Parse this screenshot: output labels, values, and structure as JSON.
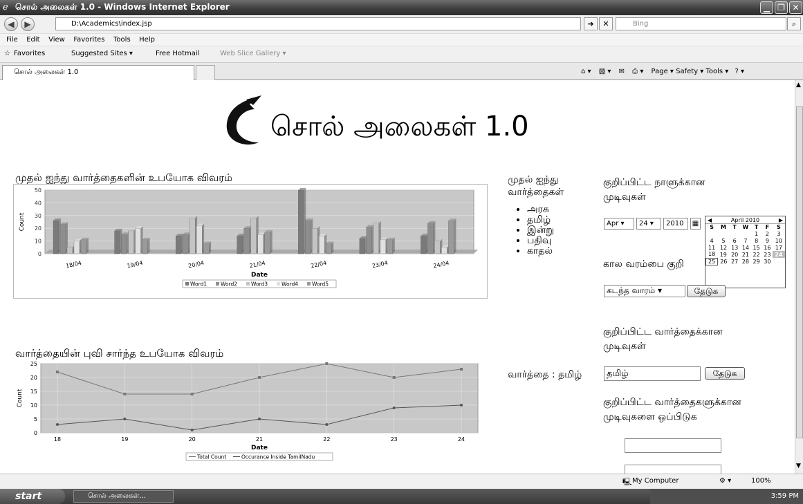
{
  "window": {
    "title": "சொல் அலைகள் 1.0 - Windows Internet Explorer",
    "address": "D:\\Academics\\index.jsp",
    "search_placeholder": "Bing",
    "menu": [
      "File",
      "Edit",
      "View",
      "Favorites",
      "Tools",
      "Help"
    ],
    "favorites": {
      "label": "Favorites",
      "items": [
        "Suggested Sites ▾",
        "Free Hotmail",
        "Web Slice Gallery ▾"
      ]
    },
    "tab_label": "சொல் அலைகள் 1.0",
    "commands": "Page ▾   Safety ▾   Tools ▾",
    "status": {
      "zone": "My Computer",
      "zoom": "100%"
    },
    "taskbar": {
      "start": "start",
      "task": "சொல் அலைகள்...",
      "clock": "3:59 PM"
    }
  },
  "page": {
    "app_title": "சொல் அலைகள் 1.0",
    "chart1_title": "முதல் ஐந்து வார்த்தைகளின் உபயோக விவரம்",
    "chart2_title": "வார்த்தையின் புவி சார்ந்த உபயோக விவரம்",
    "top_words": {
      "heading_line1": "முதல் ஐந்து",
      "heading_line2": "வார்த்தைகள்",
      "items": [
        "அரசு",
        "தமிழ்",
        "இன்று",
        "பதிவு",
        "காதல்"
      ]
    },
    "date_results": {
      "heading_line1": "குறிப்பிட்ட நாளுக்கான",
      "heading_line2": "முடிவுகள்",
      "month": "Apr",
      "day": "24",
      "year": "2010"
    },
    "range": {
      "heading": "கால வரம்பை குறி",
      "select_value": "கடந்த வாரம்",
      "button": "தேடுக"
    },
    "word_results": {
      "heading_line1": "குறிப்பிட்ட வார்த்தைக்கான",
      "heading_line2": "முடிவுகள்",
      "label": "வார்த்தை : தமிழ்",
      "input_value": "தமிழ்",
      "button": "தேடுக"
    },
    "compare": {
      "heading_line1": "குறிப்பிட்ட வார்த்தைகளுக்கான",
      "heading_line2": "முடிவுகளை ஒப்பிடுக"
    },
    "calendar": {
      "title": "April 2010",
      "weekdays": [
        "S",
        "M",
        "T",
        "W",
        "T",
        "F",
        "S"
      ],
      "weeks": [
        [
          "",
          "",
          "",
          "",
          "1",
          "2",
          "3"
        ],
        [
          "4",
          "5",
          "6",
          "7",
          "8",
          "9",
          "10"
        ],
        [
          "11",
          "12",
          "13",
          "14",
          "15",
          "16",
          "17"
        ],
        [
          "18",
          "19",
          "20",
          "21",
          "22",
          "23",
          "24"
        ],
        [
          "25",
          "26",
          "27",
          "28",
          "29",
          "30",
          ""
        ]
      ],
      "selected": "24",
      "today": "25"
    }
  },
  "chart_data": [
    {
      "type": "bar",
      "xlabel": "Date",
      "ylabel": "Count",
      "ylim": [
        0,
        50
      ],
      "yticks": [
        0,
        10,
        20,
        30,
        40,
        50
      ],
      "categories": [
        "18/04",
        "19/04",
        "20/04",
        "21/04",
        "22/04",
        "23/04",
        "24/04"
      ],
      "series": [
        {
          "name": "Word1",
          "values": [
            26,
            18,
            14,
            14,
            50,
            12,
            14
          ],
          "color": "#7a7a7a"
        },
        {
          "name": "Word2",
          "values": [
            23,
            15,
            15,
            20,
            26,
            21,
            24
          ],
          "color": "#8e8e8e"
        },
        {
          "name": "Word3",
          "values": [
            5,
            18,
            28,
            28,
            20,
            24,
            10
          ],
          "color": "#c4c4c4"
        },
        {
          "name": "Word4",
          "values": [
            10,
            20,
            22,
            15,
            14,
            11,
            5
          ],
          "color": "#e0e0e0"
        },
        {
          "name": "Word5",
          "values": [
            11,
            11,
            8,
            17,
            8,
            11,
            26
          ],
          "color": "#9a9a9a"
        }
      ],
      "legend": "bottom"
    },
    {
      "type": "line",
      "xlabel": "Date",
      "ylabel": "Count",
      "ylim": [
        0,
        25
      ],
      "yticks": [
        0,
        5,
        10,
        15,
        20,
        25
      ],
      "x": [
        18,
        19,
        20,
        21,
        22,
        23,
        24
      ],
      "series": [
        {
          "name": "Total Count",
          "values": [
            22,
            14,
            14,
            20,
            25,
            20,
            23
          ],
          "color": "#777777",
          "marker": "square"
        },
        {
          "name": "Occurance Inside TamilNadu",
          "values": [
            3,
            5,
            1,
            5,
            3,
            9,
            10
          ],
          "color": "#555555",
          "marker": "circle"
        }
      ],
      "legend": "bottom"
    }
  ]
}
